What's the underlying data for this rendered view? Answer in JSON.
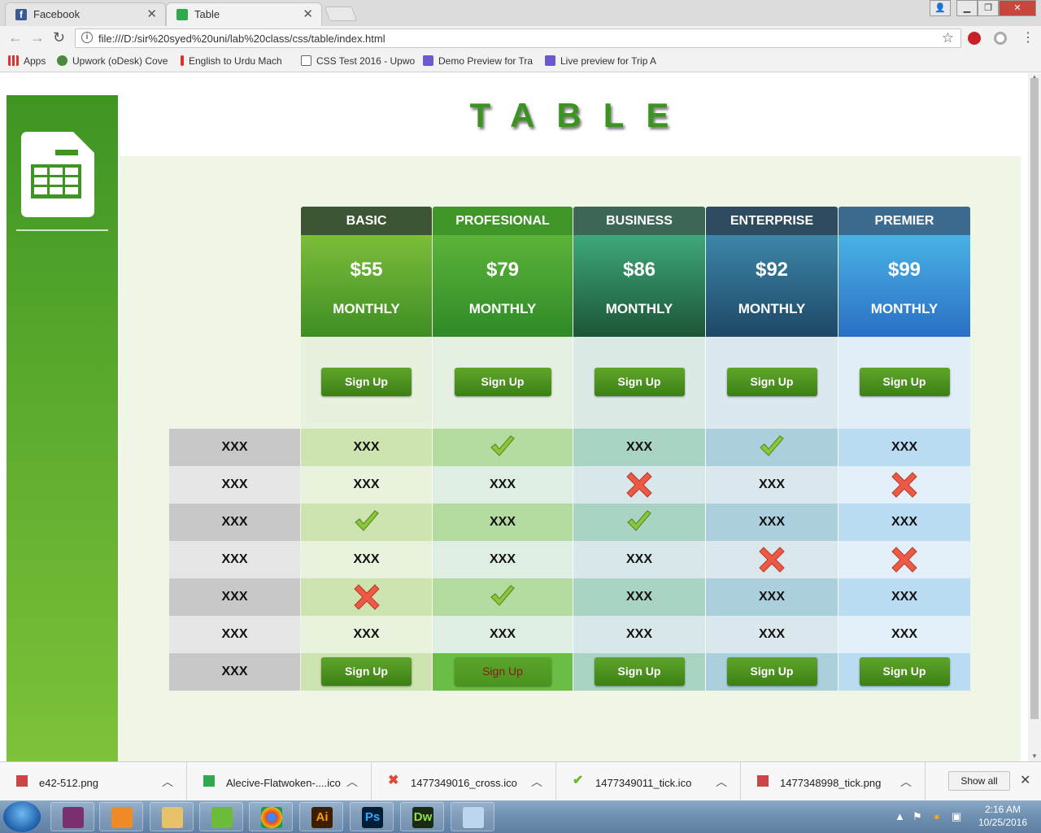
{
  "browser": {
    "tabs": [
      {
        "title": "Facebook",
        "icon": "facebook-icon"
      },
      {
        "title": "Table",
        "icon": "sheet-icon"
      }
    ],
    "url": "file:///D:/sir%20syed%20uni/lab%20class/css/table/index.html",
    "bookmarks": [
      {
        "label": "Apps",
        "icon": "apps-grid-icon"
      },
      {
        "label": "Upwork (oDesk) Cove",
        "icon": "upwork-icon"
      },
      {
        "label": "English to Urdu Mach",
        "icon": "bookmark-icon"
      },
      {
        "label": "CSS Test 2016 - Upwo",
        "icon": "page-icon"
      },
      {
        "label": "Demo Preview for Tra",
        "icon": "preview-icon"
      },
      {
        "label": "Live preview for Trip A",
        "icon": "preview-icon"
      }
    ]
  },
  "page": {
    "heading": "TABLE",
    "plans": [
      {
        "name": "BASIC",
        "price": "$55",
        "period": "MONTHLY",
        "signup": "Sign Up",
        "bottom_signup": "Sign Up",
        "header_color": "#3d5532",
        "price_color_top": "#7cbd3a",
        "price_color_bottom": "#3e8e24",
        "area_color": "#e8f1dd",
        "row_odd": "#cde3b0",
        "row_even": "#e8f2dc"
      },
      {
        "name": "PROFESIONAL",
        "price": "$79",
        "period": "MONTHLY",
        "signup": "Sign Up",
        "bottom_signup": "Sign Up",
        "header_color": "#3f9628",
        "price_color_top": "#5cb43a",
        "price_color_bottom": "#2f8a27",
        "area_color": "#e4f0e0",
        "row_odd": "#b4dba0",
        "row_even": "#dfeee2"
      },
      {
        "name": "BUSINESS",
        "price": "$86",
        "period": "MONTHLY",
        "signup": "Sign Up",
        "bottom_signup": "Sign Up",
        "header_color": "#3e6656",
        "price_color_top": "#3ea87a",
        "price_color_bottom": "#1c5535",
        "area_color": "#dceae6",
        "row_odd": "#a9d4c3",
        "row_even": "#d8e8ea"
      },
      {
        "name": "ENTERPRISE",
        "price": "$92",
        "period": "MONTHLY",
        "signup": "Sign Up",
        "bottom_signup": "Sign Up",
        "header_color": "#2e4c5f",
        "price_color_top": "#3d86a8",
        "price_color_bottom": "#1e4766",
        "area_color": "#dbe9ee",
        "row_odd": "#abcfdd",
        "row_even": "#dae8ee"
      },
      {
        "name": "PREMIER",
        "price": "$99",
        "period": "MONTHLY",
        "signup": "Sign Up",
        "bottom_signup": "Sign Up",
        "header_color": "#3c6b8f",
        "price_color_top": "#4ab2e6",
        "price_color_bottom": "#2a6fc4",
        "area_color": "#e1eef8",
        "row_odd": "#b9dcf3",
        "row_even": "#e3f0fa"
      }
    ],
    "row_labels": [
      "XXX",
      "XXX",
      "XXX",
      "XXX",
      "XXX",
      "XXX",
      "XXX"
    ],
    "cells": [
      [
        "XXX",
        "tick",
        "XXX",
        "tick",
        "XXX"
      ],
      [
        "XXX",
        "XXX",
        "cross",
        "XXX",
        "cross"
      ],
      [
        "tick",
        "XXX",
        "tick",
        "XXX",
        "XXX"
      ],
      [
        "XXX",
        "XXX",
        "XXX",
        "cross",
        "cross"
      ],
      [
        "cross",
        "tick",
        "XXX",
        "XXX",
        "XXX"
      ],
      [
        "XXX",
        "XXX",
        "XXX",
        "XXX",
        "XXX"
      ]
    ],
    "label_colors": {
      "odd": "#c8c8c8",
      "even": "#e6e6e6"
    }
  },
  "downloads": {
    "items": [
      {
        "name": "e42-512.png",
        "icon": "image-file-icon"
      },
      {
        "name": "Alecive-Flatwoken-....ico",
        "icon": "sheet-icon"
      },
      {
        "name": "1477349016_cross.ico",
        "icon": "cross-icon"
      },
      {
        "name": "1477349011_tick.ico",
        "icon": "tick-icon"
      },
      {
        "name": "1477348998_tick.png",
        "icon": "image-file-icon"
      }
    ],
    "show_all": "Show all"
  },
  "taskbar": {
    "apps": [
      {
        "name": "winrar",
        "label": ""
      },
      {
        "name": "media-player",
        "label": ""
      },
      {
        "name": "file-explorer",
        "label": ""
      },
      {
        "name": "utorrent",
        "label": ""
      },
      {
        "name": "chrome",
        "label": ""
      },
      {
        "name": "illustrator",
        "label": "Ai"
      },
      {
        "name": "photoshop",
        "label": "Ps"
      },
      {
        "name": "dreamweaver",
        "label": "Dw"
      },
      {
        "name": "notepad",
        "label": ""
      }
    ],
    "time": "2:16 AM",
    "date": "10/25/2016"
  }
}
